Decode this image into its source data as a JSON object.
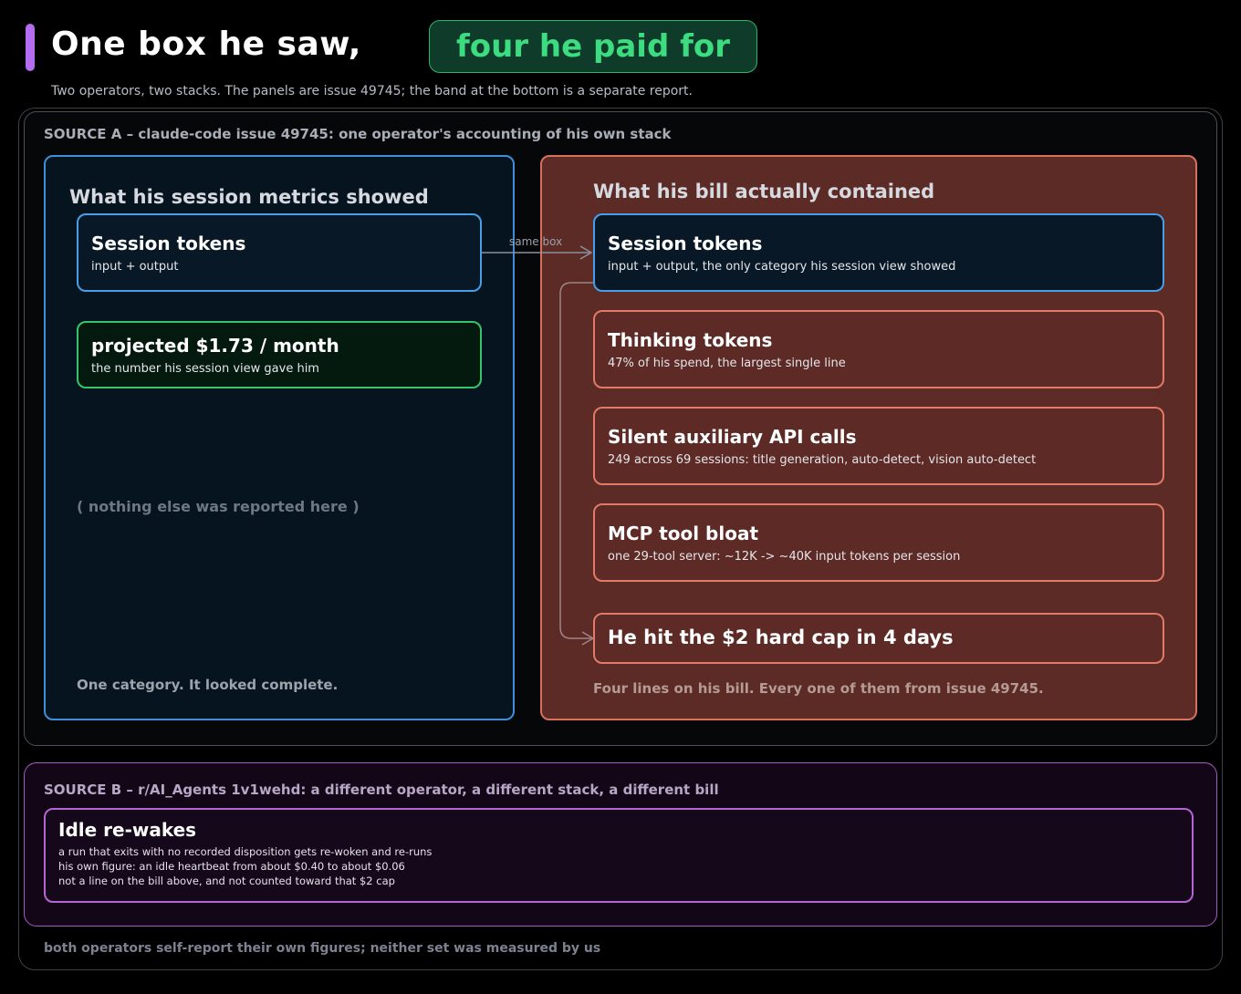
{
  "header": {
    "title_left": "One box he saw,",
    "title_right": "four he paid for",
    "subtitle": "Two operators, two stacks. The panels are issue 49745; the band at the bottom is a separate report."
  },
  "source_a": {
    "label": "SOURCE A – claude-code issue 49745: one operator's accounting of his own stack",
    "left_panel": {
      "heading": "What his session metrics showed",
      "session_card": {
        "title": "Session tokens",
        "sub": "input + output"
      },
      "projected_card": {
        "title": "projected $1.73 / month",
        "sub": "the number his session view gave him"
      },
      "nothing_note": "( nothing else was reported here )",
      "footer": "One category. It looked complete."
    },
    "arrow_label": "same box",
    "right_panel": {
      "heading": "What his bill actually contained",
      "session_card": {
        "title": "Session tokens",
        "sub": "input + output, the only category his session view showed"
      },
      "thinking_card": {
        "title": "Thinking tokens",
        "sub": "47% of his spend, the largest single line"
      },
      "aux_card": {
        "title": "Silent auxiliary API calls",
        "sub": "249 across 69 sessions: title generation, auto-detect, vision auto-detect"
      },
      "mcp_card": {
        "title": "MCP tool bloat",
        "sub": "one 29-tool server: ~12K -> ~40K input tokens per session"
      },
      "cap_card": {
        "title": "He hit the $2 hard cap in 4 days"
      },
      "footer": "Four lines on his bill. Every one of them from issue 49745."
    }
  },
  "source_b": {
    "label": "SOURCE B – r/AI_Agents 1v1wehd: a different operator, a different stack, a different bill",
    "card": {
      "title": "Idle re-wakes",
      "lines": [
        "a run that exits with no recorded disposition gets re-woken and re-runs",
        "his own figure: an idle heartbeat from about $0.40 to about $0.06",
        "not a line on the bill above, and not counted toward that $2 cap"
      ]
    }
  },
  "footnote": "both operators self-report their own figures; neither set was measured by us",
  "colors": {
    "accent_purple": "#b46cf0",
    "pill_green": "#3ddc80",
    "blue_border": "#4a9ee8",
    "green_border": "#35c46b",
    "red_border": "#e17a66",
    "purple_border": "#b665d6"
  }
}
